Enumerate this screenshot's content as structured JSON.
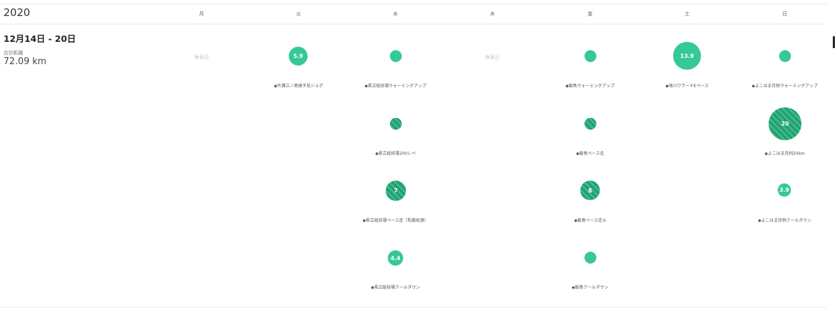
{
  "year": "2020",
  "days": [
    "月",
    "火",
    "水",
    "木",
    "金",
    "土",
    "日"
  ],
  "week": {
    "range": "12月14日 - 20日",
    "total_label": "合計距離",
    "total_value": "72.09 km"
  },
  "rest_label": "休息日",
  "workouts": {
    "tue": [
      {
        "value": "5.9",
        "label": "◆片瀬江ノ島様子見ジョグ"
      }
    ],
    "wed": [
      {
        "value": "",
        "label": "◆県立総技場ウォーミングアップ"
      },
      {
        "value": "",
        "label": "◆県立総技場200レペ"
      },
      {
        "value": "7",
        "label": "◆県立総技場ペース走（乳酸処理）"
      },
      {
        "value": "4.4",
        "label": "◆県立総技場クールダウン"
      }
    ],
    "fri": [
      {
        "value": "",
        "label": "◆飯島ウォーミングアップ"
      },
      {
        "value": "",
        "label": "◆飯島ペース走"
      },
      {
        "value": "8",
        "label": "◆飯島ペース走②"
      },
      {
        "value": "",
        "label": "◆飯島クールダウン"
      }
    ],
    "sat": [
      {
        "value": "13.9",
        "label": "◆境川ワラーチEペース"
      }
    ],
    "sun": [
      {
        "value": "",
        "label": "◆よこはま月例ウォーミングアップ"
      },
      {
        "value": "20",
        "label": "◆よこはま月例20km"
      },
      {
        "value": "3.9",
        "label": "◆よこはま月例クールダウン"
      }
    ]
  }
}
